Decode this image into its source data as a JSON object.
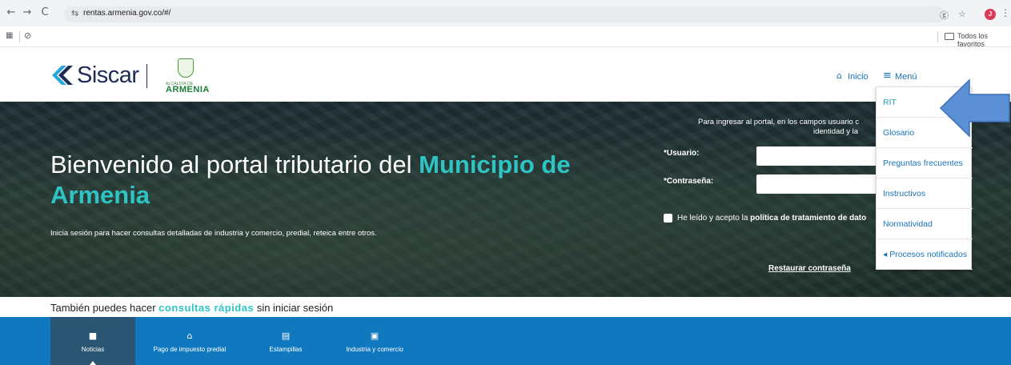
{
  "browser": {
    "url": "rentas.armenia.gov.co/#/",
    "back_icon": "←",
    "forward_icon": "→",
    "reload_icon": "C",
    "tune_icon": "⇆",
    "translate_icon": "ⓖ",
    "star_icon": "☆",
    "profile_initial": "J",
    "menu_icon": "⋮",
    "apps_icon": "▦",
    "globe_icon": "⊘",
    "all_bookmarks": "Todos los favoritos"
  },
  "header": {
    "brand": "Siscar",
    "alcaldia_label": "ALCALDÍA DE",
    "city_logo": "ARMENIA",
    "home_label": "Inicio",
    "menu_label": "Menú"
  },
  "hero": {
    "title_plain": "Bienvenido al portal tributario del ",
    "title_accent": "Municipio de Armenia",
    "subtitle": "Inicia sesión para hacer consultas detalladas de industria y comercio, predial, reteica entre otros."
  },
  "login": {
    "intro_line1": "Para ingresar al portal, en los campos usuario c",
    "intro_line2": "identidad y la",
    "user_label": "*Usuario:",
    "password_label": "*Contraseña:",
    "terms_prefix": "He leído y acepto la ",
    "terms_link": "política de tratamiento de dato",
    "restore_password": "Restaurar contraseña"
  },
  "menu_dropdown": {
    "items": [
      {
        "label": "RIT"
      },
      {
        "label": "Glosario"
      },
      {
        "label": "Preguntas frecuentes"
      },
      {
        "label": "Instructivos"
      },
      {
        "label": "Normatividad"
      },
      {
        "label": "◂ Procesos notificados"
      }
    ]
  },
  "quick": {
    "prefix": "También puedes hacer ",
    "accent": "consultas rápidas",
    "suffix": " sin iniciar sesión",
    "tabs": [
      {
        "label": "Noticias",
        "icon": "video-icon",
        "glyph": "■",
        "active": true
      },
      {
        "label": "Pago de impuesto predial",
        "icon": "home-icon",
        "glyph": "⌂",
        "active": false
      },
      {
        "label": "Estampillas",
        "icon": "document-icon",
        "glyph": "▤",
        "active": false
      },
      {
        "label": "Industria y comercio",
        "icon": "store-icon",
        "glyph": "▣",
        "active": false
      }
    ]
  },
  "colors": {
    "accent_teal": "#2ec4c4",
    "link_blue": "#1a73b8",
    "bar_blue": "#0f78bf",
    "brand_navy": "#1e2b57",
    "arrow_blue": "#5b8fd6"
  }
}
